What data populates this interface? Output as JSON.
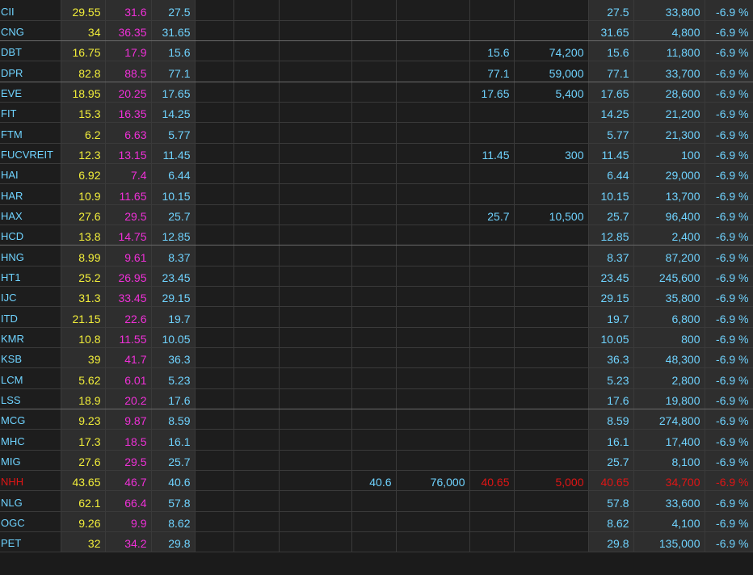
{
  "colors": {
    "symbol": "#6fd3ff",
    "ceiling": "#f030d8",
    "reference": "#f2ee3a",
    "floor": "#6fd3ff",
    "down": "#e01515"
  },
  "rows": [
    {
      "sym": "CII",
      "ref": "29.55",
      "ceil": "31.6",
      "floor": "27.5",
      "b3p": "",
      "b3v": "",
      "b2p": "",
      "b2v": "",
      "b1p": "",
      "b1v": "",
      "lp": "27.5",
      "lv": "33,800",
      "chg": "-6.9 %"
    },
    {
      "sym": "CNG",
      "ref": "34",
      "ceil": "36.35",
      "floor": "31.65",
      "b3p": "",
      "b3v": "",
      "b2p": "",
      "b2v": "",
      "b1p": "",
      "b1v": "",
      "lp": "31.65",
      "lv": "4,800",
      "chg": "-6.9 %"
    },
    {
      "sym": "DBT",
      "ref": "16.75",
      "ceil": "17.9",
      "floor": "15.6",
      "b3p": "",
      "b3v": "",
      "b2p": "",
      "b2v": "",
      "b1p": "15.6",
      "b1v": "74,200",
      "lp": "15.6",
      "lv": "11,800",
      "chg": "-6.9 %"
    },
    {
      "sym": "DPR",
      "ref": "82.8",
      "ceil": "88.5",
      "floor": "77.1",
      "b3p": "",
      "b3v": "",
      "b2p": "",
      "b2v": "",
      "b1p": "77.1",
      "b1v": "59,000",
      "lp": "77.1",
      "lv": "33,700",
      "chg": "-6.9 %"
    },
    {
      "sym": "EVE",
      "ref": "18.95",
      "ceil": "20.25",
      "floor": "17.65",
      "b3p": "",
      "b3v": "",
      "b2p": "",
      "b2v": "",
      "b1p": "17.65",
      "b1v": "5,400",
      "lp": "17.65",
      "lv": "28,600",
      "chg": "-6.9 %"
    },
    {
      "sym": "FIT",
      "ref": "15.3",
      "ceil": "16.35",
      "floor": "14.25",
      "b3p": "",
      "b3v": "",
      "b2p": "",
      "b2v": "",
      "b1p": "",
      "b1v": "",
      "lp": "14.25",
      "lv": "21,200",
      "chg": "-6.9 %"
    },
    {
      "sym": "FTM",
      "ref": "6.2",
      "ceil": "6.63",
      "floor": "5.77",
      "b3p": "",
      "b3v": "",
      "b2p": "",
      "b2v": "",
      "b1p": "",
      "b1v": "",
      "lp": "5.77",
      "lv": "21,300",
      "chg": "-6.9 %"
    },
    {
      "sym": "FUCVREIT",
      "ref": "12.3",
      "ceil": "13.15",
      "floor": "11.45",
      "b3p": "",
      "b3v": "",
      "b2p": "",
      "b2v": "",
      "b1p": "11.45",
      "b1v": "300",
      "lp": "11.45",
      "lv": "100",
      "chg": "-6.9 %"
    },
    {
      "sym": "HAI",
      "ref": "6.92",
      "ceil": "7.4",
      "floor": "6.44",
      "b3p": "",
      "b3v": "",
      "b2p": "",
      "b2v": "",
      "b1p": "",
      "b1v": "",
      "lp": "6.44",
      "lv": "29,000",
      "chg": "-6.9 %"
    },
    {
      "sym": "HAR",
      "ref": "10.9",
      "ceil": "11.65",
      "floor": "10.15",
      "b3p": "",
      "b3v": "",
      "b2p": "",
      "b2v": "",
      "b1p": "",
      "b1v": "",
      "lp": "10.15",
      "lv": "13,700",
      "chg": "-6.9 %"
    },
    {
      "sym": "HAX",
      "ref": "27.6",
      "ceil": "29.5",
      "floor": "25.7",
      "b3p": "",
      "b3v": "",
      "b2p": "",
      "b2v": "",
      "b1p": "25.7",
      "b1v": "10,500",
      "lp": "25.7",
      "lv": "96,400",
      "chg": "-6.9 %"
    },
    {
      "sym": "HCD",
      "ref": "13.8",
      "ceil": "14.75",
      "floor": "12.85",
      "b3p": "",
      "b3v": "",
      "b2p": "",
      "b2v": "",
      "b1p": "",
      "b1v": "",
      "lp": "12.85",
      "lv": "2,400",
      "chg": "-6.9 %"
    },
    {
      "sym": "HNG",
      "ref": "8.99",
      "ceil": "9.61",
      "floor": "8.37",
      "b3p": "",
      "b3v": "",
      "b2p": "",
      "b2v": "",
      "b1p": "",
      "b1v": "",
      "lp": "8.37",
      "lv": "87,200",
      "chg": "-6.9 %"
    },
    {
      "sym": "HT1",
      "ref": "25.2",
      "ceil": "26.95",
      "floor": "23.45",
      "b3p": "",
      "b3v": "",
      "b2p": "",
      "b2v": "",
      "b1p": "",
      "b1v": "",
      "lp": "23.45",
      "lv": "245,600",
      "chg": "-6.9 %"
    },
    {
      "sym": "IJC",
      "ref": "31.3",
      "ceil": "33.45",
      "floor": "29.15",
      "b3p": "",
      "b3v": "",
      "b2p": "",
      "b2v": "",
      "b1p": "",
      "b1v": "",
      "lp": "29.15",
      "lv": "35,800",
      "chg": "-6.9 %"
    },
    {
      "sym": "ITD",
      "ref": "21.15",
      "ceil": "22.6",
      "floor": "19.7",
      "b3p": "",
      "b3v": "",
      "b2p": "",
      "b2v": "",
      "b1p": "",
      "b1v": "",
      "lp": "19.7",
      "lv": "6,800",
      "chg": "-6.9 %"
    },
    {
      "sym": "KMR",
      "ref": "10.8",
      "ceil": "11.55",
      "floor": "10.05",
      "b3p": "",
      "b3v": "",
      "b2p": "",
      "b2v": "",
      "b1p": "",
      "b1v": "",
      "lp": "10.05",
      "lv": "800",
      "chg": "-6.9 %"
    },
    {
      "sym": "KSB",
      "ref": "39",
      "ceil": "41.7",
      "floor": "36.3",
      "b3p": "",
      "b3v": "",
      "b2p": "",
      "b2v": "",
      "b1p": "",
      "b1v": "",
      "lp": "36.3",
      "lv": "48,300",
      "chg": "-6.9 %"
    },
    {
      "sym": "LCM",
      "ref": "5.62",
      "ceil": "6.01",
      "floor": "5.23",
      "b3p": "",
      "b3v": "",
      "b2p": "",
      "b2v": "",
      "b1p": "",
      "b1v": "",
      "lp": "5.23",
      "lv": "2,800",
      "chg": "-6.9 %"
    },
    {
      "sym": "LSS",
      "ref": "18.9",
      "ceil": "20.2",
      "floor": "17.6",
      "b3p": "",
      "b3v": "",
      "b2p": "",
      "b2v": "",
      "b1p": "",
      "b1v": "",
      "lp": "17.6",
      "lv": "19,800",
      "chg": "-6.9 %"
    },
    {
      "sym": "MCG",
      "ref": "9.23",
      "ceil": "9.87",
      "floor": "8.59",
      "b3p": "",
      "b3v": "",
      "b2p": "",
      "b2v": "",
      "b1p": "",
      "b1v": "",
      "lp": "8.59",
      "lv": "274,800",
      "chg": "-6.9 %"
    },
    {
      "sym": "MHC",
      "ref": "17.3",
      "ceil": "18.5",
      "floor": "16.1",
      "b3p": "",
      "b3v": "",
      "b2p": "",
      "b2v": "",
      "b1p": "",
      "b1v": "",
      "lp": "16.1",
      "lv": "17,400",
      "chg": "-6.9 %"
    },
    {
      "sym": "MIG",
      "ref": "27.6",
      "ceil": "29.5",
      "floor": "25.7",
      "b3p": "",
      "b3v": "",
      "b2p": "",
      "b2v": "",
      "b1p": "",
      "b1v": "",
      "lp": "25.7",
      "lv": "8,100",
      "chg": "-6.9 %"
    },
    {
      "sym": "NHH",
      "ref": "43.65",
      "ceil": "46.7",
      "floor": "40.6",
      "b3p": "",
      "b3v": "",
      "b2p": "40.6",
      "b2v": "76,000",
      "b1p": "40.65",
      "b1v": "5,000",
      "lp": "40.65",
      "lv": "34,700",
      "chg": "-6.9 %",
      "special": true
    },
    {
      "sym": "NLG",
      "ref": "62.1",
      "ceil": "66.4",
      "floor": "57.8",
      "b3p": "",
      "b3v": "",
      "b2p": "",
      "b2v": "",
      "b1p": "",
      "b1v": "",
      "lp": "57.8",
      "lv": "33,600",
      "chg": "-6.9 %"
    },
    {
      "sym": "OGC",
      "ref": "9.26",
      "ceil": "9.9",
      "floor": "8.62",
      "b3p": "",
      "b3v": "",
      "b2p": "",
      "b2v": "",
      "b1p": "",
      "b1v": "",
      "lp": "8.62",
      "lv": "4,100",
      "chg": "-6.9 %"
    },
    {
      "sym": "PET",
      "ref": "32",
      "ceil": "34.2",
      "floor": "29.8",
      "b3p": "",
      "b3v": "",
      "b2p": "",
      "b2v": "",
      "b1p": "",
      "b1v": "",
      "lp": "29.8",
      "lv": "135,000",
      "chg": "-6.9 %"
    }
  ]
}
